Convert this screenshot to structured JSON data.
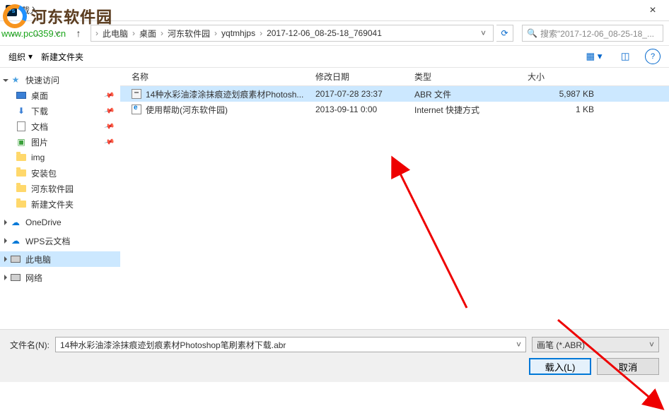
{
  "window": {
    "title": "载入"
  },
  "watermark": {
    "text": "河东软件园",
    "url": "www.pc0359.cn"
  },
  "nav": {
    "breadcrumb": [
      "此电脑",
      "桌面",
      "河东软件园",
      "yqtmhjps",
      "2017-12-06_08-25-18_769041"
    ],
    "search_placeholder": "搜索\"2017-12-06_08-25-18_..."
  },
  "toolbar": {
    "organize": "组织",
    "newfolder": "新建文件夹"
  },
  "sidebar": {
    "quick": {
      "label": "快速访问",
      "items": [
        {
          "label": "桌面",
          "pinned": true,
          "icon": "desktop"
        },
        {
          "label": "下载",
          "pinned": true,
          "icon": "download"
        },
        {
          "label": "文档",
          "pinned": true,
          "icon": "doc"
        },
        {
          "label": "图片",
          "pinned": true,
          "icon": "pic"
        },
        {
          "label": "img",
          "pinned": false,
          "icon": "folder"
        },
        {
          "label": "安装包",
          "pinned": false,
          "icon": "folder"
        },
        {
          "label": "河东软件园",
          "pinned": false,
          "icon": "folder"
        },
        {
          "label": "新建文件夹",
          "pinned": false,
          "icon": "folder"
        }
      ]
    },
    "onedrive": "OneDrive",
    "wps": "WPS云文档",
    "thispc": "此电脑",
    "network": "网络"
  },
  "columns": {
    "name": "名称",
    "date": "修改日期",
    "type": "类型",
    "size": "大小"
  },
  "files": [
    {
      "name": "14种水彩油漆涂抹痕迹划痕素材Photosh...",
      "date": "2017-07-28 23:37",
      "type": "ABR 文件",
      "size": "5,987 KB",
      "icon": "abr",
      "selected": true
    },
    {
      "name": "使用帮助(河东软件园)",
      "date": "2013-09-11 0:00",
      "type": "Internet 快捷方式",
      "size": "1 KB",
      "icon": "url",
      "selected": false
    }
  ],
  "footer": {
    "filename_label": "文件名(N):",
    "filename_value": "14种水彩油漆涂抹痕迹划痕素材Photoshop笔刷素材下载.abr",
    "filter": "画笔 (*.ABR)",
    "open": "载入(L)",
    "cancel": "取消"
  }
}
